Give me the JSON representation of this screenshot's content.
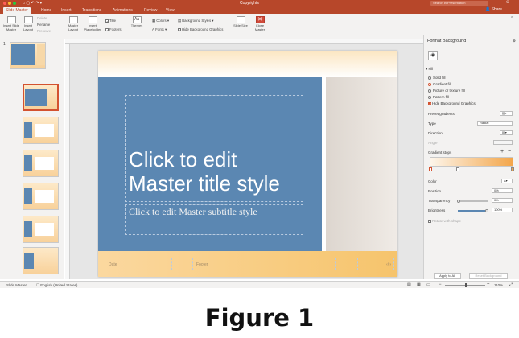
{
  "window": {
    "title": "Copyrights",
    "search_placeholder": "Search in Presentation"
  },
  "tabs": [
    "Slide Master",
    "Home",
    "Insert",
    "Transitions",
    "Animations",
    "Review",
    "View"
  ],
  "share_label": "Share",
  "ribbon": {
    "insert_slide_master": "Insert Slide Master",
    "insert_layout": "Insert Layout",
    "delete": "Delete",
    "rename": "Rename",
    "preserve": "Preserve",
    "master_layout": "Master Layout",
    "insert_placeholder": "Insert Placeholder",
    "title_check": "Title",
    "footers_check": "Footers",
    "themes": "Themes",
    "colors": "Colors",
    "fonts": "Fonts",
    "background_styles": "Background Styles",
    "hide_background_graphics": "Hide Background Graphics",
    "slide_size": "Slide Size",
    "close_master": "Close Master"
  },
  "thumbnails": {
    "first_number": "1"
  },
  "slide": {
    "title": "Click to edit Master title style",
    "subtitle": "Click to edit Master subtitle style",
    "date": "Date",
    "footer": "Footer",
    "number": "‹#›"
  },
  "format_pane": {
    "heading": "Format Background",
    "fill_section": "Fill",
    "options": [
      "Solid fill",
      "Gradient fill",
      "Picture or texture fill",
      "Pattern fill"
    ],
    "selected_option": "Gradient fill",
    "hide_bg_graphics": "Hide Background Graphics",
    "preset_gradients": "Preset gradients",
    "type_label": "Type",
    "type_value": "Radial",
    "direction_label": "Direction",
    "angle_label": "Angle",
    "gradient_stops": "Gradient stops",
    "color_label": "Color",
    "position_label": "Position",
    "position_value": "0%",
    "transparency_label": "Transparency",
    "transparency_value": "0%",
    "brightness_label": "Brightness",
    "brightness_value": "100%",
    "rotate_label": "Rotate with shape",
    "apply_all": "Apply to All",
    "reset": "Reset Background"
  },
  "statusbar": {
    "view": "Slide Master",
    "language": "English (United States)",
    "zoom": "110%"
  },
  "caption": "Figure 1",
  "colors": {
    "accent": "#b7472a",
    "slide_blue": "#5b87b2",
    "footer_orange": "#f6c46c"
  }
}
